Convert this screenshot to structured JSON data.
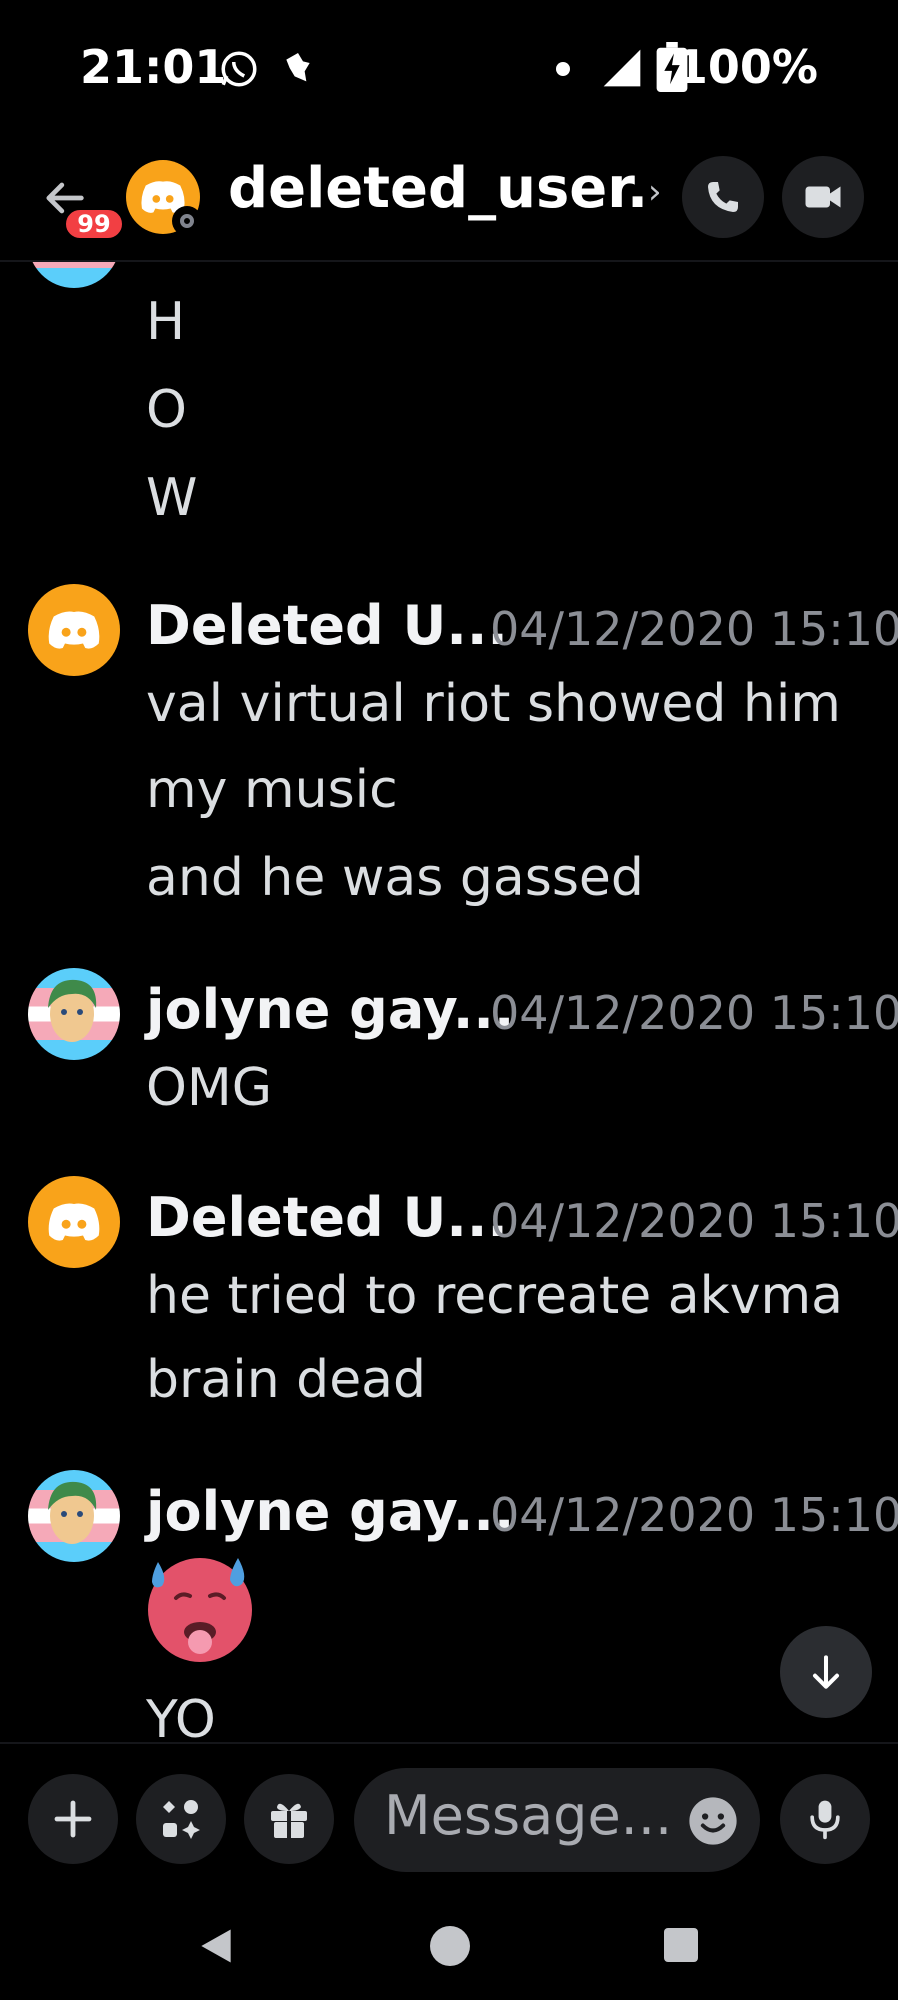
{
  "status_bar": {
    "time": "21:01",
    "battery": "100%",
    "icons": [
      "whatsapp-icon",
      "notification-icon",
      "dot-icon",
      "signal-icon",
      "battery-charging-icon"
    ]
  },
  "header": {
    "back_icon": "arrow-left-icon",
    "unread_badge": "99",
    "title": "deleted_user..",
    "chevron": "›",
    "call_icon": "phone-icon",
    "video_icon": "video-camera-icon"
  },
  "messages": [
    {
      "type": "continuation",
      "lines": [
        "H",
        "O",
        "W"
      ]
    },
    {
      "type": "group",
      "author": "Deleted U...",
      "avatar": "discord-logo",
      "timestamp": "04/12/2020 15:10",
      "lines": [
        "val virtual riot showed him",
        "my music",
        "and he was gassed"
      ]
    },
    {
      "type": "group",
      "author": "jolyne gay...",
      "avatar": "jolyne-avatar",
      "timestamp": "04/12/2020 15:10",
      "lines": [
        "OMG"
      ]
    },
    {
      "type": "group",
      "author": "Deleted U...",
      "avatar": "discord-logo",
      "timestamp": "04/12/2020 15:10",
      "lines": [
        "he tried to recreate akvma",
        "brain dead"
      ]
    },
    {
      "type": "group",
      "author": "jolyne gay...",
      "avatar": "jolyne-avatar",
      "timestamp": "04/12/2020 15:10",
      "emoji": "hot-face-emoji",
      "lines": [
        "YO"
      ]
    }
  ],
  "composer": {
    "placeholder": "Message...",
    "buttons": [
      "plus-icon",
      "apps-icon",
      "gift-icon",
      "emoji-icon",
      "microphone-icon"
    ]
  },
  "colors": {
    "background": "#000000",
    "discord_orange": "#f9a31a",
    "badge_red": "#f23f43",
    "timestamp": "#8b8e95",
    "text": "#dbdee1"
  }
}
